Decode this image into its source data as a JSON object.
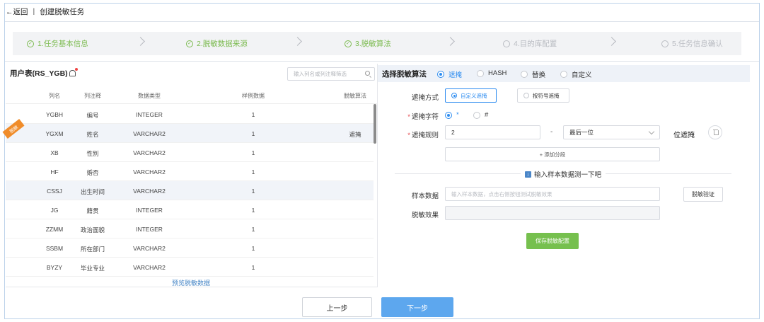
{
  "header": {
    "back_label": "←返回",
    "separator": "|",
    "title": "创建脱敏任务"
  },
  "steps": [
    {
      "label": "1.任务基本信息",
      "status": "done"
    },
    {
      "label": "2.脱敏数据来源",
      "status": "done"
    },
    {
      "label": "3.脱敏算法",
      "status": "done"
    },
    {
      "label": "4.目的库配置",
      "status": "todo"
    },
    {
      "label": "5.任务信息确认",
      "status": "todo"
    }
  ],
  "table_panel": {
    "title": "用户表(RS_YGB)",
    "search_placeholder": "输入列名或列注释筛选",
    "columns": [
      "列名",
      "列注释",
      "数据类型",
      "样例数据",
      "脱敏算法"
    ],
    "rows": [
      {
        "name": "YGBH",
        "comment": "编号",
        "type": "INTEGER",
        "sample": "1",
        "algorithm": ""
      },
      {
        "name": "YGXM",
        "comment": "姓名",
        "type": "VARCHAR2",
        "sample": "1",
        "algorithm": "遮掩",
        "badge": "脱敏"
      },
      {
        "name": "XB",
        "comment": "性别",
        "type": "VARCHAR2",
        "sample": "1",
        "algorithm": ""
      },
      {
        "name": "HF",
        "comment": "婚否",
        "type": "VARCHAR2",
        "sample": "1",
        "algorithm": ""
      },
      {
        "name": "CSSJ",
        "comment": "出生时间",
        "type": "VARCHAR2",
        "sample": "1",
        "algorithm": ""
      },
      {
        "name": "JG",
        "comment": "籍贯",
        "type": "INTEGER",
        "sample": "1",
        "algorithm": ""
      },
      {
        "name": "ZZMM",
        "comment": "政治面貌",
        "type": "INTEGER",
        "sample": "1",
        "algorithm": ""
      },
      {
        "name": "SSBM",
        "comment": "所在部门",
        "type": "VARCHAR2",
        "sample": "1",
        "algorithm": ""
      },
      {
        "name": "BYZY",
        "comment": "毕业专业",
        "type": "VARCHAR2",
        "sample": "1",
        "algorithm": ""
      }
    ],
    "preview_label": "预览脱敏数据"
  },
  "algorithm_panel": {
    "title": "选择脱敏算法",
    "options": [
      {
        "label": "遮掩",
        "selected": true
      },
      {
        "label": "HASH",
        "selected": false
      },
      {
        "label": "替换",
        "selected": false
      },
      {
        "label": "自定义",
        "selected": false
      }
    ],
    "mask_mode_label": "遮掩方式",
    "mask_modes": [
      {
        "label": "自定义遮掩",
        "selected": true
      },
      {
        "label": "按符号遮掩",
        "selected": false
      }
    ],
    "mask_char_label": "遮掩字符",
    "mask_chars": [
      {
        "label": "*",
        "selected": true
      },
      {
        "label": "#",
        "selected": false
      }
    ],
    "mask_rule_label": "遮掩规则",
    "rule_value": "2",
    "rule_dash": "-",
    "rule_position": "最后一位",
    "rule_suffix": "位遮掩",
    "add_segment_label": "+ 添加分段",
    "test_divider": "输入样本数据测一下吧",
    "sample_label": "样本数据",
    "sample_placeholder": "输入样本数据，点击右侧按钮测试脱敏效果",
    "verify_button": "脱敏验证",
    "result_label": "脱敏效果",
    "save_button": "保存脱敏配置"
  },
  "footer": {
    "prev_label": "上一步",
    "next_label": "下一步"
  },
  "colors": {
    "accent": "#2d8cf0",
    "done": "#7cbb50",
    "next_button": "#5da7ee",
    "save_button": "#76c04e",
    "badge": "#f08c2a"
  }
}
